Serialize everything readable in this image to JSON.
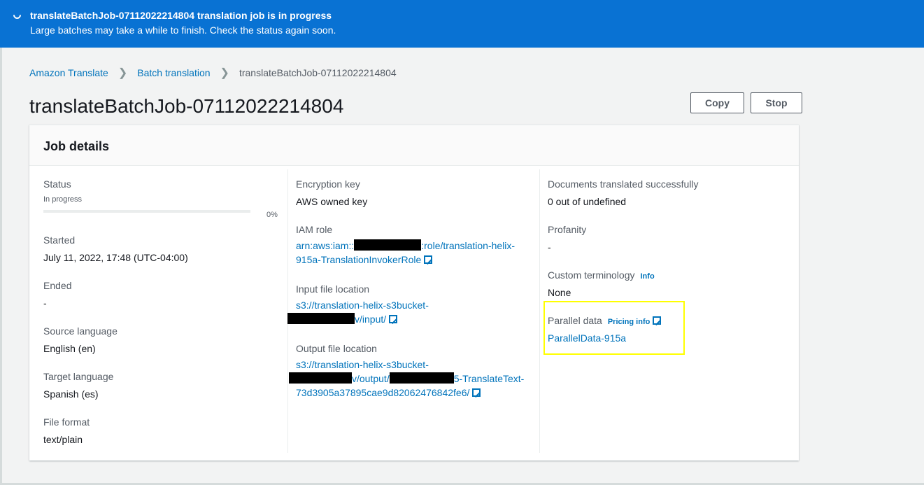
{
  "banner": {
    "title": "translateBatchJob-07112022214804 translation job is in progress",
    "subtitle": "Large batches may take a while to finish. Check the status again soon."
  },
  "breadcrumb": {
    "items": [
      "Amazon Translate",
      "Batch translation",
      "translateBatchJob-07112022214804"
    ]
  },
  "page": {
    "title": "translateBatchJob-07112022214804",
    "copy_label": "Copy",
    "stop_label": "Stop"
  },
  "card": {
    "title": "Job details"
  },
  "col1": {
    "status_label": "Status",
    "status_value": "In progress",
    "progress_percent": "0%",
    "progress_fraction": 0,
    "started_label": "Started",
    "started_value": "July 11, 2022, 17:48 (UTC-04:00)",
    "ended_label": "Ended",
    "ended_value": "-",
    "source_label": "Source language",
    "source_value": "English (en)",
    "target_label": "Target language",
    "target_value": "Spanish (es)",
    "format_label": "File format",
    "format_value": "text/plain"
  },
  "col2": {
    "enc_label": "Encryption key",
    "enc_value": "AWS owned key",
    "iam_label": "IAM role",
    "iam_part1": "arn:aws:iam::",
    "iam_part2": ":role/translation-helix-",
    "iam_part3": "915a-TranslationInvokerRole",
    "input_label": "Input file location",
    "input_part1": "s3://translation-helix-s3bucket-",
    "input_part2": "v/input/",
    "output_label": "Output file location",
    "output_part1": "s3://translation-helix-s3bucket-",
    "output_part2": "v/output/",
    "output_part3": "5-TranslateText-",
    "output_part4": "73d3905a37895cae9d82062476842fe6/"
  },
  "col3": {
    "docs_label": "Documents translated successfully",
    "docs_value": "0 out of undefined",
    "profanity_label": "Profanity",
    "profanity_value": "-",
    "terminology_label": "Custom terminology",
    "terminology_info": "Info",
    "terminology_value": "None",
    "parallel_label": "Parallel data",
    "parallel_info": "Pricing info",
    "parallel_value": "ParallelData-915a"
  },
  "colors": {
    "banner": "#0972d3",
    "link": "#0073bb",
    "highlight": "#ffff00"
  }
}
